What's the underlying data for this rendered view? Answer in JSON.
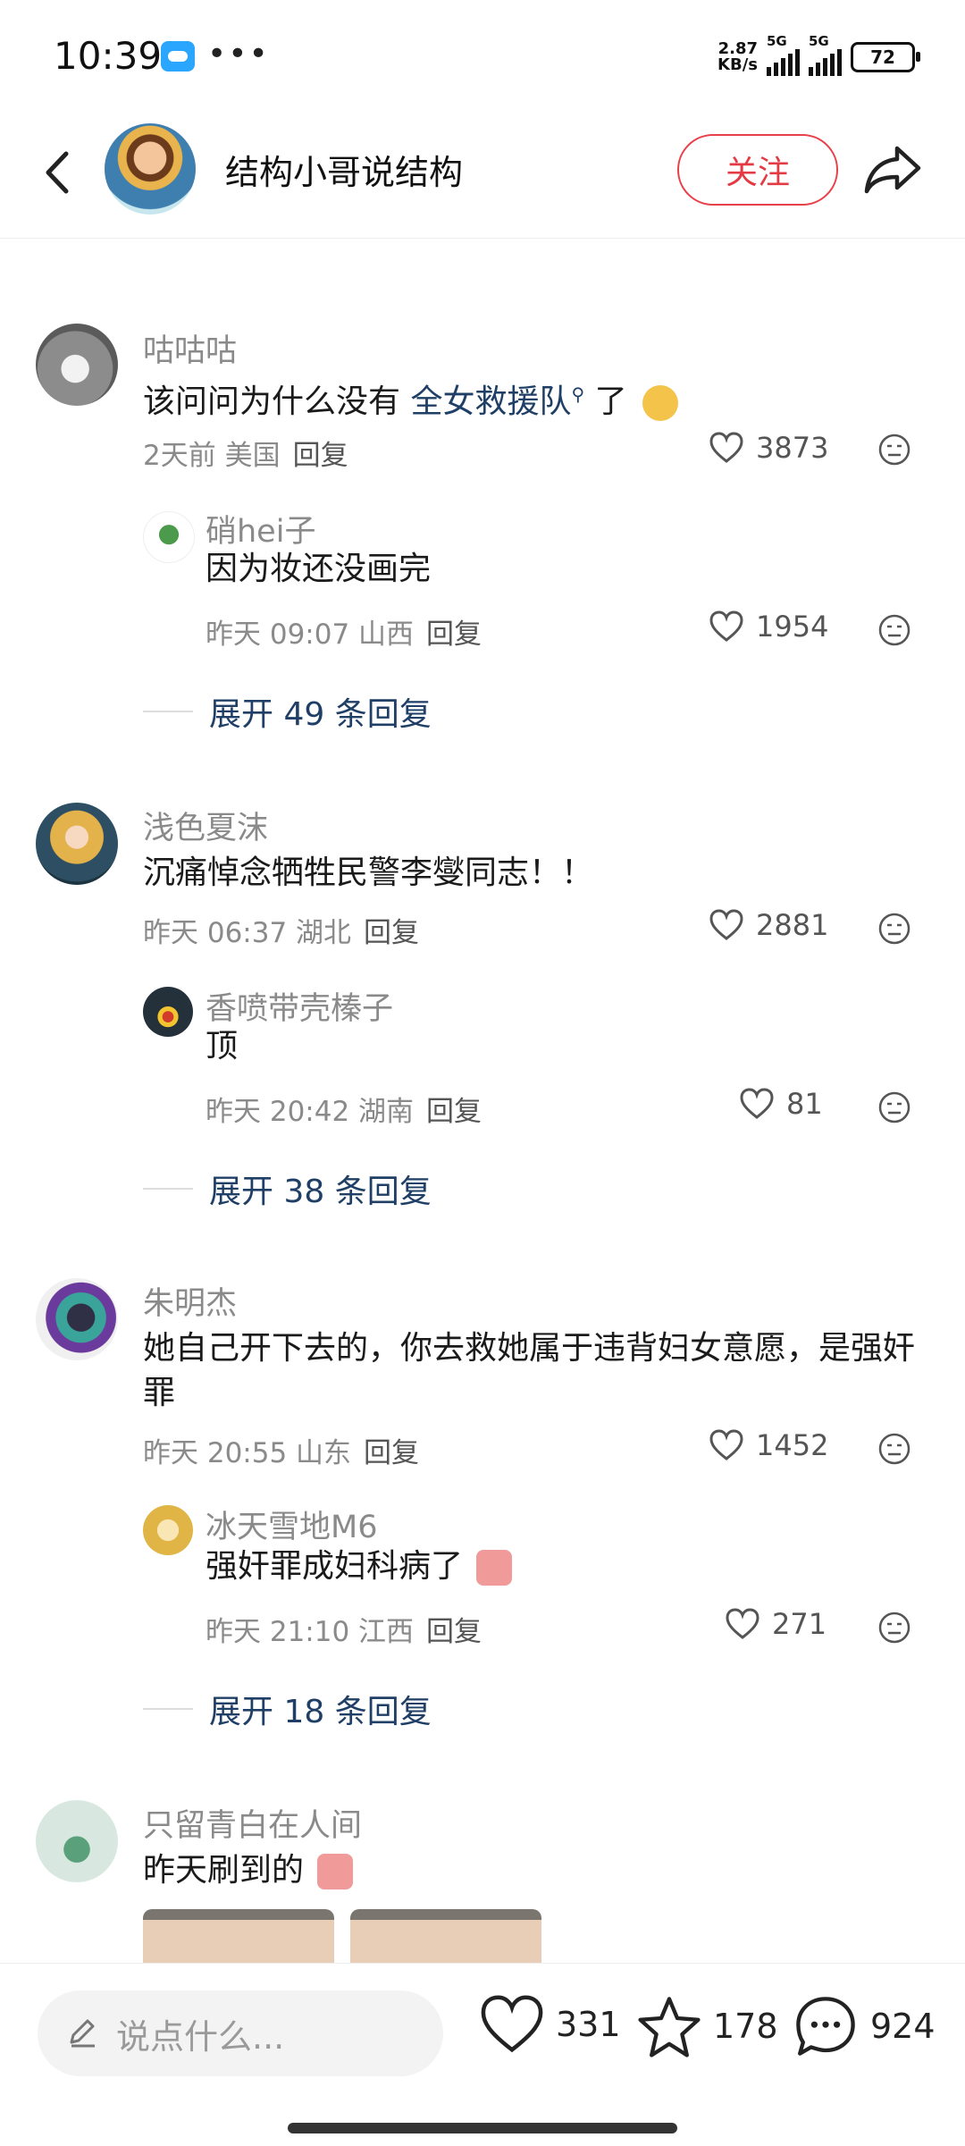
{
  "status_bar": {
    "time": "10:39",
    "speed_value": "2.87",
    "speed_unit": "KB/s",
    "network1": "5G",
    "network2": "5G",
    "battery": "72"
  },
  "header": {
    "title": "结构小哥说结构",
    "follow_label": "关注"
  },
  "comments": [
    {
      "user": "咕咕咕",
      "text_before": "该问问为什么没有 ",
      "link": "全女救援队",
      "text_after": " 了",
      "meta": "2天前 美国",
      "reply_label": "回复",
      "likes": "3873",
      "reply": {
        "user": "硝hei子",
        "text": "因为妆还没画完",
        "meta": "昨天 09:07 山西",
        "reply_label": "回复",
        "likes": "1954"
      },
      "expand": "展开 49 条回复"
    },
    {
      "user": "浅色夏沫",
      "text": "沉痛悼念牺牲民警李燮同志！！",
      "meta": "昨天 06:37 湖北",
      "reply_label": "回复",
      "likes": "2881",
      "reply": {
        "user": "香喷带壳榛子",
        "text": "顶",
        "meta": "昨天 20:42 湖南",
        "reply_label": "回复",
        "likes": "81"
      },
      "expand": "展开 38 条回复"
    },
    {
      "user": "朱明杰",
      "text": "她自己开下去的，你去救她属于违背妇女意愿，是强奸罪",
      "meta": "昨天 20:55 山东",
      "reply_label": "回复",
      "likes": "1452",
      "reply": {
        "user": "冰天雪地M6",
        "text": "强奸罪成妇科病了",
        "meta": "昨天 21:10 江西",
        "reply_label": "回复",
        "likes": "271"
      },
      "expand": "展开 18 条回复"
    },
    {
      "user": "只留青白在人间",
      "text": "昨天刷到的"
    }
  ],
  "bottom_bar": {
    "placeholder": "说点什么...",
    "likes": "331",
    "favorites": "178",
    "comments": "924"
  },
  "colors": {
    "accent": "#e33a44",
    "link": "#1f3f66",
    "muted": "#8a8a8a"
  }
}
